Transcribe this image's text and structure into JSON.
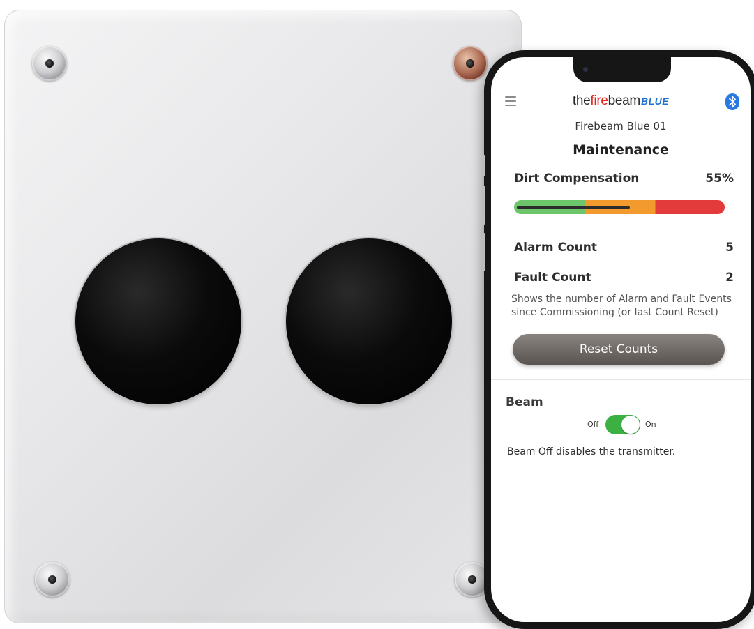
{
  "app": {
    "brand": {
      "part1": "the",
      "part2": "fire",
      "part3": "beam",
      "part4": "BLUE"
    },
    "device_name": "Firebeam Blue 01",
    "page_title": "Maintenance"
  },
  "dirt_compensation": {
    "label": "Dirt Compensation",
    "value_text": "55%",
    "level": 0.55,
    "bar_colors": [
      "#6dc56b",
      "#f29a2e",
      "#e33b3b"
    ]
  },
  "counts": {
    "alarm_label": "Alarm Count",
    "alarm_value": "5",
    "fault_label": "Fault Count",
    "fault_value": "2",
    "description": "Shows the number of Alarm and Fault Events since Commissioning (or last Count Reset)",
    "reset_label": "Reset Counts"
  },
  "beam": {
    "title": "Beam",
    "off_label": "Off",
    "on_label": "On",
    "state": "on",
    "note": "Beam Off disables the transmitter."
  },
  "icons": {
    "menu": "hamburger-menu-icon",
    "bluetooth": "bluetooth-icon"
  },
  "colors": {
    "brand_red": "#e2231a",
    "brand_blue": "#1f6fce",
    "bluetooth_blue": "#2979e3",
    "toggle_on": "#3cb043"
  }
}
